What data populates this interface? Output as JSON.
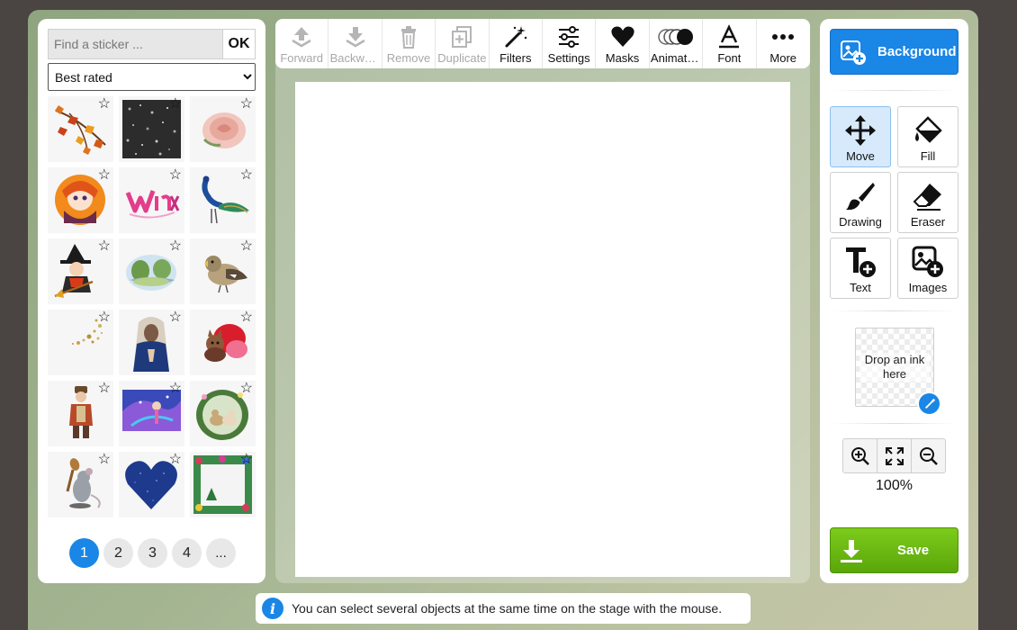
{
  "sticker_panel": {
    "search_placeholder": "Find a sticker ...",
    "ok_label": "OK",
    "sort_selected": "Best rated",
    "sort_options": [
      "Best rated"
    ],
    "star_glyph": "☆",
    "stickers": [
      {
        "icon": "autumn-leaves-icon"
      },
      {
        "icon": "black-glitter-icon"
      },
      {
        "icon": "rose-icon"
      },
      {
        "icon": "anime-girl-icon"
      },
      {
        "icon": "winx-logo-icon"
      },
      {
        "icon": "peacock-icon"
      },
      {
        "icon": "witch-icon"
      },
      {
        "icon": "landscape-icon"
      },
      {
        "icon": "bird-icon"
      },
      {
        "icon": "golden-sparkles-icon"
      },
      {
        "icon": "madonna-icon"
      },
      {
        "icon": "cat-roses-icon"
      },
      {
        "icon": "old-man-icon"
      },
      {
        "icon": "fairy-icon"
      },
      {
        "icon": "dogs-frame-icon"
      },
      {
        "icon": "mouse-chef-icon"
      },
      {
        "icon": "blue-heart-icon"
      },
      {
        "icon": "christmas-frame-icon"
      }
    ],
    "pages": [
      "1",
      "2",
      "3",
      "4",
      "..."
    ],
    "active_page": "1"
  },
  "toolbar": {
    "items": [
      {
        "label": "Forward",
        "icon": "forward-icon",
        "disabled": true
      },
      {
        "label": "Backward",
        "icon": "backward-icon",
        "disabled": true
      },
      {
        "label": "Remove",
        "icon": "trash-icon",
        "disabled": true
      },
      {
        "label": "Duplicate",
        "icon": "duplicate-icon",
        "disabled": true
      },
      {
        "label": "Filters",
        "icon": "magic-wand-icon",
        "disabled": false
      },
      {
        "label": "Settings",
        "icon": "sliders-icon",
        "disabled": false
      },
      {
        "label": "Masks",
        "icon": "heart-icon",
        "disabled": false
      },
      {
        "label": "Animations",
        "icon": "animation-icon",
        "disabled": false
      },
      {
        "label": "Font",
        "icon": "font-icon",
        "disabled": false
      },
      {
        "label": "More",
        "icon": "more-icon",
        "disabled": false
      }
    ]
  },
  "tip": {
    "text": "You can select several objects at the same time on the stage with the mouse."
  },
  "right_panel": {
    "background_label": "Background",
    "tools": [
      {
        "label": "Move",
        "icon": "move-icon",
        "active": true
      },
      {
        "label": "Fill",
        "icon": "paint-bucket-icon",
        "active": false
      },
      {
        "label": "Drawing",
        "icon": "brush-icon",
        "active": false
      },
      {
        "label": "Eraser",
        "icon": "eraser-icon",
        "active": false
      },
      {
        "label": "Text",
        "icon": "text-add-icon",
        "active": false
      },
      {
        "label": "Images",
        "icon": "image-add-icon",
        "active": false
      }
    ],
    "ink_drop_text": "Drop an ink here",
    "zoom_level": "100%",
    "save_label": "Save"
  },
  "colors": {
    "accent": "#1a86e6",
    "save_green": "#6cba12",
    "background_frame": "#a3b491",
    "outer_background": "#4a4443"
  }
}
